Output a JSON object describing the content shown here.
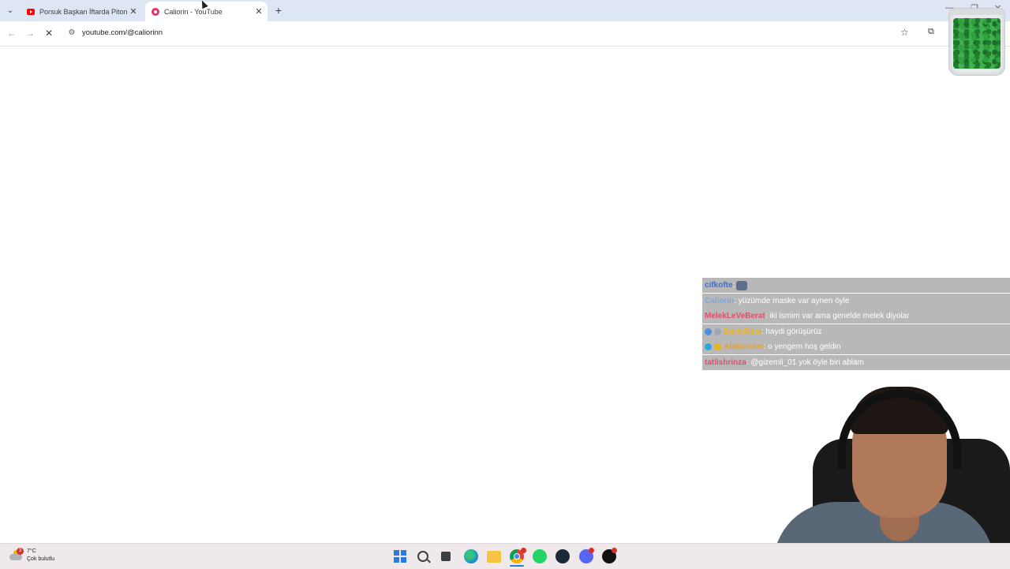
{
  "browser": {
    "tabs": [
      {
        "title": "Porsuk Başkan İftarda Piton Sar",
        "active": false,
        "favicon": "youtube-icon"
      },
      {
        "title": "Caliorin - YouTube",
        "active": true,
        "favicon": "channel-icon"
      }
    ],
    "url": "youtube.com/@caliorinn"
  },
  "chat": {
    "messages": [
      {
        "user": "cifkofte",
        "user_color": "#3b6fd8",
        "text": "",
        "emote": true
      },
      {
        "user": "Caliorin",
        "user_color": "#7fa6d9",
        "text": " : yüzümde maske var aynen öyle"
      },
      {
        "user": "MelekLeVeBerat",
        "user_color": "#e0506d",
        "text": " : iki ismim var ama genelde melek diyolar"
      },
      {
        "user": "DavikReis",
        "user_color": "#e8b423",
        "text": " : haydi görüşürüz"
      },
      {
        "user": "Atakanism",
        "user_color": "#f0a020",
        "text": " : o yengem hoş geldin"
      },
      {
        "user": "tatlishrinza",
        "user_color": "#e0506d",
        "text": " : @gizemli_01 yok öyle biri ablam"
      }
    ]
  },
  "taskbar": {
    "weather_temp": "7°C",
    "weather_desc": "Çok bulutlu",
    "weather_badge": "3"
  }
}
